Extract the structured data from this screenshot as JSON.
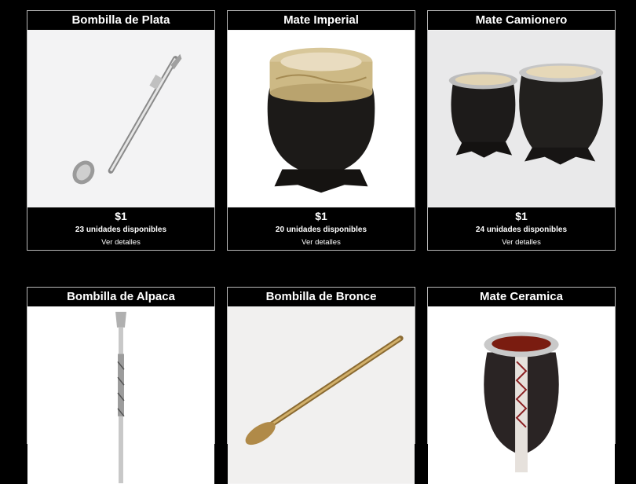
{
  "products": [
    {
      "name": "Bombilla de Plata",
      "price": "$1",
      "stock": "23 unidades disponibles",
      "details": "Ver detalles"
    },
    {
      "name": "Mate Imperial",
      "price": "$1",
      "stock": "20 unidades disponibles",
      "details": "Ver detalles"
    },
    {
      "name": "Mate Camionero",
      "price": "$1",
      "stock": "24 unidades disponibles",
      "details": "Ver detalles"
    },
    {
      "name": "Bombilla de Alpaca"
    },
    {
      "name": "Bombilla de Bronce"
    },
    {
      "name": "Mate Ceramica"
    }
  ]
}
